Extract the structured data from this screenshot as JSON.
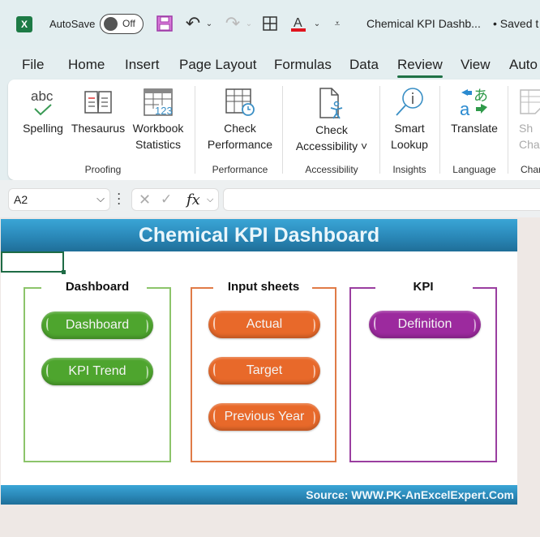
{
  "titlebar": {
    "app_icon": "excel-icon",
    "autosave_label": "AutoSave",
    "autosave_state": "Off",
    "document_title": "Chemical KPI Dashb...",
    "save_status": "• Saved t"
  },
  "tabs": [
    {
      "label": "File",
      "active": false
    },
    {
      "label": "Home",
      "active": false
    },
    {
      "label": "Insert",
      "active": false
    },
    {
      "label": "Page Layout",
      "active": false
    },
    {
      "label": "Formulas",
      "active": false
    },
    {
      "label": "Data",
      "active": false
    },
    {
      "label": "Review",
      "active": true
    },
    {
      "label": "View",
      "active": false
    },
    {
      "label": "Auto",
      "active": false
    }
  ],
  "ribbon": {
    "buttons": {
      "spelling": {
        "line1": "Spelling",
        "icon_text": "abc"
      },
      "thesaurus": {
        "line1": "Thesaurus"
      },
      "workbook_statistics": {
        "line1": "Workbook",
        "line2": "Statistics",
        "icon_text": "123"
      },
      "check_performance": {
        "line1": "Check",
        "line2": "Performance"
      },
      "check_accessibility": {
        "line1": "Check",
        "line2": "Accessibility ˅"
      },
      "smart_lookup": {
        "line1": "Smart",
        "line2": "Lookup"
      },
      "translate": {
        "line1": "Translate"
      },
      "show_changes": {
        "line1": "Sh",
        "line2": "Char"
      }
    },
    "groups": {
      "proofing": "Proofing",
      "performance": "Performance",
      "accessibility": "Accessibility",
      "insights": "Insights",
      "language": "Language",
      "changes": "Char"
    }
  },
  "formula_bar": {
    "name_box": "A2",
    "fx_label": "fx",
    "formula_value": ""
  },
  "sheet": {
    "title": "Chemical KPI Dashboard",
    "footer": "Source: WWW.PK-AnExcelExpert.Com",
    "groups": [
      {
        "title": "Dashboard",
        "color": "#8cc46a",
        "buttons": [
          "Dashboard",
          "KPI Trend"
        ],
        "button_color": "#4ea52e"
      },
      {
        "title": "Input sheets",
        "color": "#e07b47",
        "buttons": [
          "Actual",
          "Target",
          "Previous Year"
        ],
        "button_color": "#e8692a"
      },
      {
        "title": "KPI",
        "color": "#9a3ea0",
        "buttons": [
          "Definition"
        ],
        "button_color": "#9c2a9e"
      }
    ]
  },
  "colors": {
    "banner": "#2a88b8",
    "excel_green": "#1e7145"
  }
}
